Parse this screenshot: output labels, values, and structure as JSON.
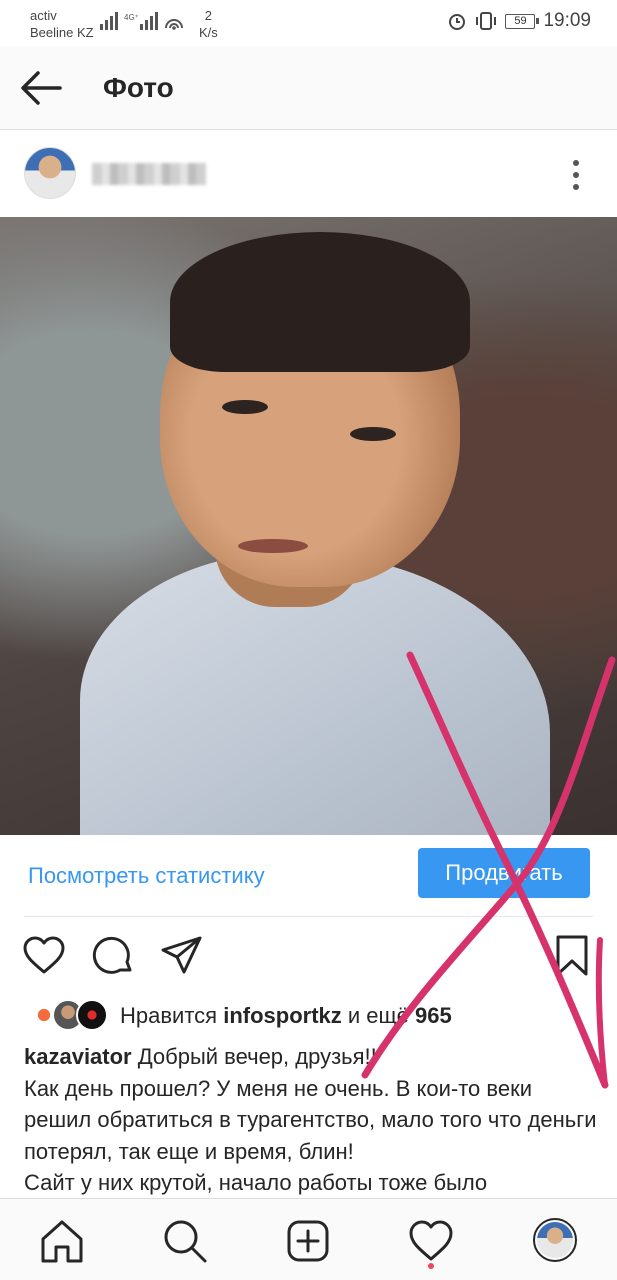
{
  "status_bar": {
    "carrier_line1": "activ",
    "carrier_line2": "Beeline KZ",
    "network": "4G⁺",
    "speed_value": "2",
    "speed_unit": "K/s",
    "battery": "59",
    "time": "19:09"
  },
  "header": {
    "title": "Фото",
    "back_icon": "arrow-left-icon"
  },
  "post": {
    "username": "",
    "more_icon": "more-vertical-icon",
    "stats_link": "Посмотреть статистику",
    "promote_label": "Продвигать",
    "likes": {
      "prefix": "Нравится ",
      "user": "infosportkz",
      "middle": " и ещё ",
      "count": "965"
    },
    "caption": {
      "author": "kazaviator",
      "line1": " Добрый вечер, друзья!!",
      "line2": "Как день прошел? У меня не очень. В кои-то веки решил обратиться в турагентство, мало того что деньги потерял, так еще и время, блин!",
      "line3": "Сайт у них крутой, начало работы тоже было"
    }
  },
  "actions": [
    "heart-icon",
    "comment-icon",
    "share-icon",
    "bookmark-icon"
  ],
  "bottom_nav": [
    "home-icon",
    "search-icon",
    "add-post-icon",
    "activity-heart-icon",
    "profile-avatar"
  ],
  "colors": {
    "accent": "#3897f0",
    "overlay_mark": "#d6336c",
    "notification_dot": "#ed4956"
  }
}
